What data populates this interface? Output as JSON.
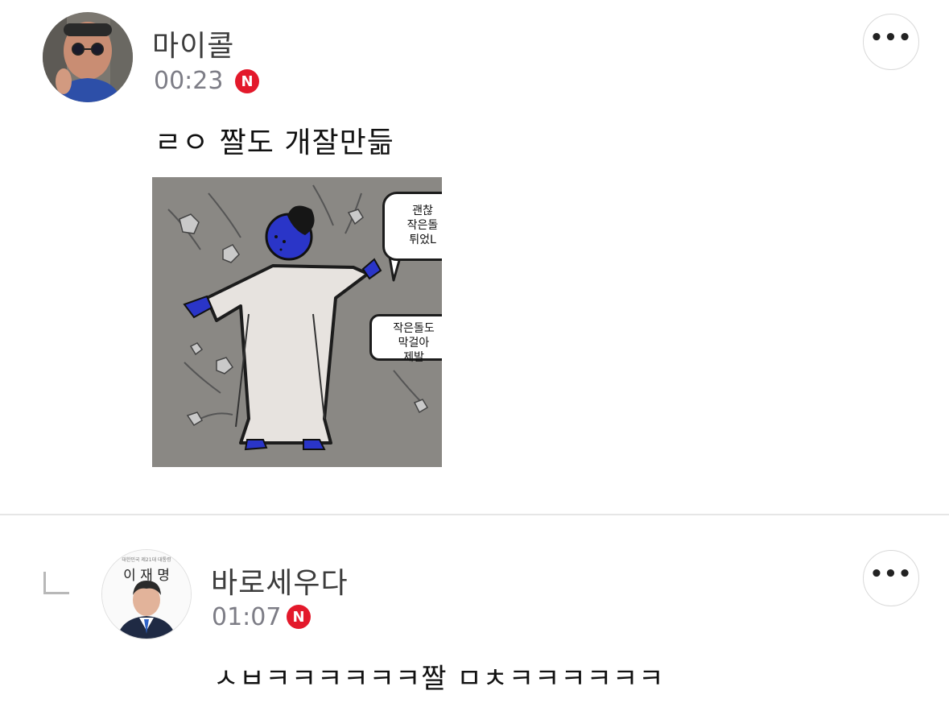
{
  "comments": [
    {
      "username": "마이콜",
      "time": "00:23",
      "badge": "N",
      "text": "ㄹㅇ 짤도 개잘만듦",
      "more_label": "•••",
      "attachment": {
        "bubble_top_lines": [
          "괜찮",
          "작은돌",
          "튀었L"
        ],
        "bubble_side_lines": [
          "작은돌도",
          "막걸아",
          "제발"
        ]
      }
    },
    {
      "username": "바로세우다",
      "time": "01:07",
      "badge": "N",
      "text": "ㅅㅂㅋㅋㅋㅋㅋㅋ짤 ㅁㅊㅋㅋㅋㅋㅋㅋ",
      "more_label": "•••",
      "avatar_name": "이 재 명",
      "avatar_caption": "대한민국 제21대 대통령"
    }
  ],
  "colors": {
    "badge": "#e3192b",
    "meta_text": "#7d7d86",
    "divider": "#e6e6e6",
    "image_bg": "#8a8884",
    "figure_skin": "#2a35c8"
  }
}
